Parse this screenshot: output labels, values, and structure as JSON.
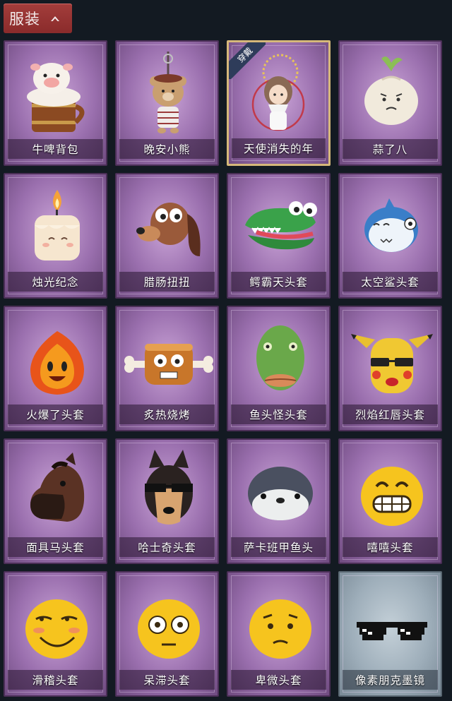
{
  "header": {
    "title": "服装"
  },
  "items": [
    {
      "label": "牛啤背包",
      "icon": "beer-keg-cow-backpack"
    },
    {
      "label": "晚安小熊",
      "icon": "teddy-bear-keychain"
    },
    {
      "label": "天使消失的年",
      "icon": "angel-girl-doll",
      "badge": "穿戴"
    },
    {
      "label": "蒜了八",
      "icon": "garlic-head"
    },
    {
      "label": "烛光纪念",
      "icon": "candle-head"
    },
    {
      "label": "腊肠扭扭",
      "icon": "dachshund-head"
    },
    {
      "label": "鳄霸天头套",
      "icon": "crocodile-head"
    },
    {
      "label": "太空鲨头套",
      "icon": "space-shark-head"
    },
    {
      "label": "火爆了头套",
      "icon": "fire-head"
    },
    {
      "label": "炙热烧烤",
      "icon": "bbq-meat-head"
    },
    {
      "label": "鱼头怪头套",
      "icon": "fish-monster-head"
    },
    {
      "label": "烈焰红唇头套",
      "icon": "yellow-pika-head"
    },
    {
      "label": "面具马头套",
      "icon": "horse-mask-head"
    },
    {
      "label": "哈士奇头套",
      "icon": "husky-head"
    },
    {
      "label": "萨卡班甲鱼头",
      "icon": "sacabambaspis-head"
    },
    {
      "label": "嘻嘻头套",
      "icon": "grin-emoji-head"
    },
    {
      "label": "滑稽头套",
      "icon": "smirk-emoji-head"
    },
    {
      "label": "呆滞头套",
      "icon": "dazed-emoji-head"
    },
    {
      "label": "卑微头套",
      "icon": "humble-emoji-head"
    },
    {
      "label": "像素朋克墨镜",
      "icon": "pixel-sunglasses"
    }
  ],
  "colors": {
    "background": "#131a22",
    "card_purple": "#9a6fae",
    "card_grey": "#9eaeba",
    "header_red": "#a33d3b",
    "equipped_border": "#d6b87a"
  }
}
